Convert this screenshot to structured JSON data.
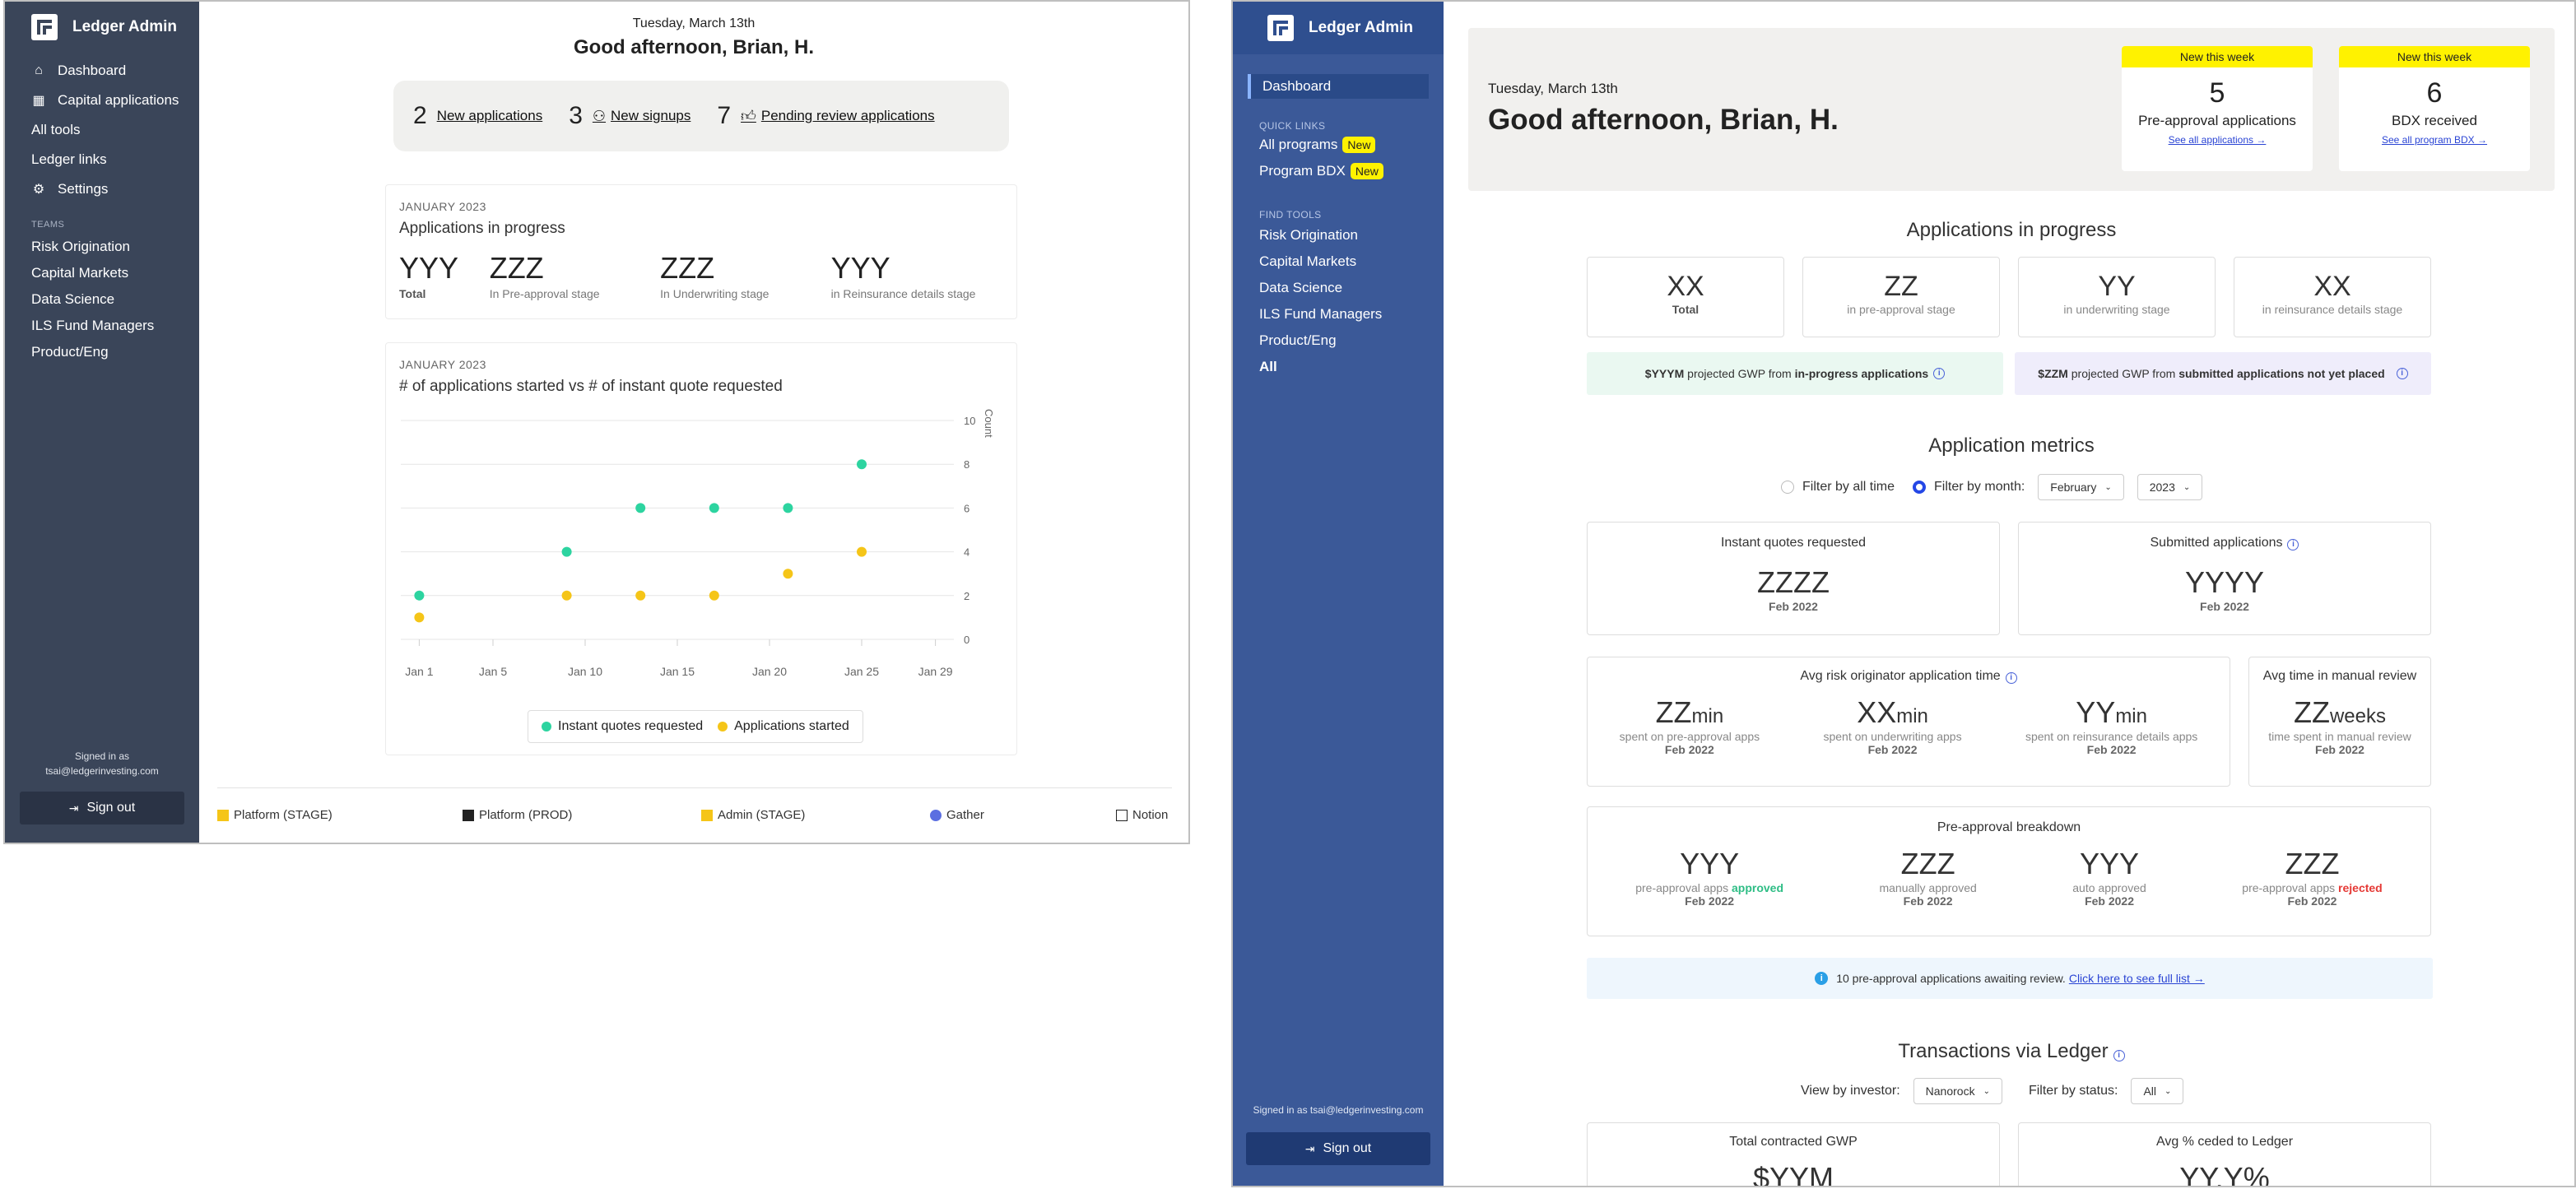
{
  "left": {
    "brand": "Ledger Admin",
    "nav": [
      {
        "label": "Dashboard",
        "icon": "home-icon"
      },
      {
        "label": "Capital applications",
        "icon": "grid-icon"
      },
      {
        "label": "All tools",
        "icon": ""
      },
      {
        "label": "Ledger links",
        "icon": ""
      },
      {
        "label": "Settings",
        "icon": "gear-icon"
      }
    ],
    "teams_label": "TEAMS",
    "teams": [
      "Risk Origination",
      "Capital Markets",
      "Data Science",
      "ILS Fund Managers",
      "Product/Eng"
    ],
    "signed_in_label": "Signed in as",
    "signed_in_email": "tsai@ledgerinvesting.com",
    "sign_out": "Sign out",
    "date": "Tuesday, March 13th",
    "greeting": "Good afternoon, Brian, H.",
    "pill": [
      {
        "num": "2",
        "label": "New applications"
      },
      {
        "num": "3",
        "label": "New signups"
      },
      {
        "num": "7",
        "label": "Pending review applications"
      }
    ],
    "progress_card": {
      "kicker": "JANUARY 2023",
      "title": "Applications in progress",
      "stats": [
        {
          "value": "YYY",
          "label": "Total"
        },
        {
          "value": "ZZZ",
          "label": "In Pre-approval stage"
        },
        {
          "value": "ZZZ",
          "label": "In Underwriting stage"
        },
        {
          "value": "YYY",
          "label": "in Reinsurance details stage"
        }
      ]
    },
    "chart_card": {
      "kicker": "JANUARY 2023",
      "title": "# of applications started vs # of instant quote requested"
    },
    "footer": [
      {
        "label": "Platform (STAGE)",
        "icon": "ledger-logo-yellow-icon"
      },
      {
        "label": "Platform (PROD)",
        "icon": "ledger-logo-dark-icon"
      },
      {
        "label": "Admin (STAGE)",
        "icon": "ledger-logo-yellow-icon"
      },
      {
        "label": "Gather",
        "icon": "gather-icon"
      },
      {
        "label": "Notion",
        "icon": "notion-icon"
      }
    ],
    "colors": {
      "sidebar": "#3a4559",
      "teal": "#2dd4a0",
      "yellow": "#f5c518"
    }
  },
  "chart_data": {
    "type": "scatter",
    "title": "# of applications started vs # of instant quote requested",
    "ylabel": "Count",
    "xlabel": "",
    "x_ticks": [
      "Jan 1",
      "Jan 5",
      "Jan 10",
      "Jan 15",
      "Jan 20",
      "Jan 25",
      "Jan 29"
    ],
    "y_ticks": [
      "0",
      "2",
      "4",
      "6",
      "8",
      "10"
    ],
    "xlim": [
      0,
      30
    ],
    "ylim": [
      0,
      10
    ],
    "series": [
      {
        "name": "Instant quotes requested",
        "color": "#2dd4a0",
        "points": [
          [
            1,
            2
          ],
          [
            9,
            4
          ],
          [
            13,
            6
          ],
          [
            17,
            6
          ],
          [
            21,
            6
          ],
          [
            25,
            8
          ]
        ]
      },
      {
        "name": "Applications started",
        "color": "#f5c518",
        "points": [
          [
            1,
            1
          ],
          [
            9,
            2
          ],
          [
            13,
            2
          ],
          [
            17,
            2
          ],
          [
            21,
            3
          ],
          [
            25,
            4
          ]
        ]
      }
    ],
    "legend": "bottom-center",
    "grid": true
  },
  "right": {
    "brand": "Ledger Admin",
    "dashboard": "Dashboard",
    "quick_links_label": "QUICK LINKS",
    "quick_links": [
      {
        "label": "All programs",
        "badge": "New"
      },
      {
        "label": "Program BDX",
        "badge": "New"
      }
    ],
    "find_tools_label": "FIND TOOLS",
    "tools": [
      "Risk Origination",
      "Capital Markets",
      "Data Science",
      "ILS Fund Managers",
      "Product/Eng",
      "All"
    ],
    "signed_in": "Signed in as tsai@ledgerinvesting.com",
    "sign_out": "Sign out",
    "date": "Tuesday, March 13th",
    "greeting": "Good afternoon, Brian, H.",
    "week_cards": [
      {
        "tag": "New this week",
        "num": "5",
        "label": "Pre-approval applications",
        "link": "See all applications →"
      },
      {
        "tag": "New this week",
        "num": "6",
        "label": "BDX received",
        "link": "See all program BDX →"
      }
    ],
    "apps_in_progress": {
      "title": "Applications in progress",
      "boxes": [
        {
          "value": "XX",
          "label": "Total"
        },
        {
          "value": "ZZ",
          "label": "in pre-approval stage"
        },
        {
          "value": "YY",
          "label": "in underwriting stage"
        },
        {
          "value": "XX",
          "label": "in reinsurance details stage"
        }
      ],
      "gwp_left": {
        "amount": "$YYYM",
        "text": "projected GWP from",
        "bold": "in-progress applications"
      },
      "gwp_right": {
        "amount": "$ZZM",
        "text": "projected GWP from",
        "bold": "submitted applications not yet placed"
      }
    },
    "metrics": {
      "title": "Application metrics",
      "filter_all": "Filter by all time",
      "filter_month": "Filter by month:",
      "month": "February",
      "year": "2023",
      "instant": {
        "title": "Instant quotes requested",
        "value": "ZZZZ",
        "date": "Feb 2022"
      },
      "submitted": {
        "title": "Submitted applications",
        "value": "YYYY",
        "date": "Feb 2022"
      },
      "avg_time": {
        "title": "Avg risk originator application time",
        "items": [
          {
            "value": "ZZ",
            "unit": "min",
            "sub": "spent on pre-approval apps",
            "date": "Feb 2022"
          },
          {
            "value": "XX",
            "unit": "min",
            "sub": "spent on underwriting apps",
            "date": "Feb 2022"
          },
          {
            "value": "YY",
            "unit": "min",
            "sub": "spent on reinsurance details apps",
            "date": "Feb 2022"
          }
        ]
      },
      "manual": {
        "title": "Avg time in manual review",
        "value": "ZZ",
        "unit": "weeks",
        "sub": "time spent in manual review",
        "date": "Feb 2022"
      },
      "breakdown": {
        "title": "Pre-approval breakdown",
        "items": [
          {
            "value": "YYY",
            "sub": "pre-approval apps",
            "accent": "approved",
            "date": "Feb 2022"
          },
          {
            "value": "ZZZ",
            "sub": "manually approved",
            "accent": "",
            "date": "Feb 2022"
          },
          {
            "value": "YYY",
            "sub": "auto approved",
            "accent": "",
            "date": "Feb 2022"
          },
          {
            "value": "ZZZ",
            "sub": "pre-approval apps",
            "accent": "rejected",
            "date": "Feb 2022"
          }
        ]
      },
      "notice": "10 pre-approval applications awaiting review.",
      "notice_link": "Click here to see full list →"
    },
    "transactions": {
      "title": "Transactions via Ledger",
      "view_by": "View by investor:",
      "investor": "Nanorock",
      "filter_status": "Filter by status:",
      "status": "All",
      "total_gwp": {
        "title": "Total contracted GWP",
        "value": "$YYM"
      },
      "avg_ceded": {
        "title": "Avg % ceded to Ledger",
        "value": "YY.Y%"
      }
    },
    "colors": {
      "sidebar": "#3b5998",
      "badge": "#fff200",
      "approved": "#2ebd85",
      "rejected": "#e53935",
      "link": "#2a44d4"
    }
  }
}
